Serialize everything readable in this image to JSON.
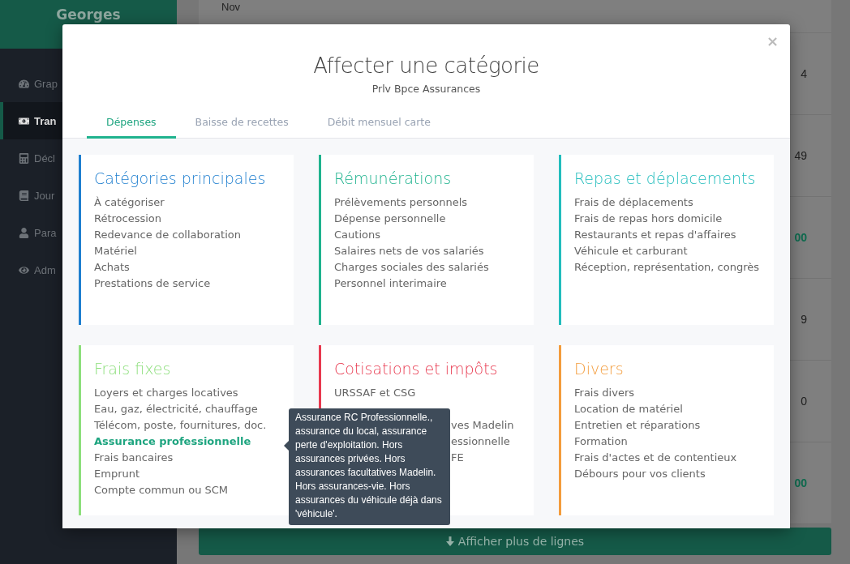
{
  "sidebar": {
    "user": "Georges",
    "items": [
      {
        "label": "Grap",
        "selected": false
      },
      {
        "label": "Tran",
        "selected": true
      },
      {
        "label": "Décl",
        "selected": false
      },
      {
        "label": "Jour",
        "selected": false
      },
      {
        "label": "Para",
        "selected": false
      },
      {
        "label": "Adm",
        "selected": false
      }
    ]
  },
  "table": {
    "first_row": "Nov",
    "rows": [
      {
        "amount": "4",
        "positive": false
      },
      {
        "amount": "49",
        "positive": false
      },
      {
        "amount": "00",
        "positive": true
      },
      {
        "amount": "9",
        "positive": false
      },
      {
        "amount": "0",
        "positive": false
      },
      {
        "amount": "00",
        "positive": true
      }
    ]
  },
  "more_button": "Afficher plus de lignes",
  "modal": {
    "title": "Affecter une catégorie",
    "subtitle": "Prlv Bpce Assurances",
    "close": "×",
    "tabs": [
      {
        "label": "Dépenses",
        "selected": true
      },
      {
        "label": "Baisse de recettes",
        "selected": false
      },
      {
        "label": "Débit mensuel carte",
        "selected": false
      }
    ],
    "groups": [
      {
        "title": "Catégories principales",
        "color": "#1f7fcf",
        "items": [
          {
            "text": "À catégoriser",
            "hovered": false
          },
          {
            "text": "Rétrocession",
            "hovered": false
          },
          {
            "text": "Redevance de collaboration",
            "hovered": false
          },
          {
            "text": "Matériel",
            "hovered": false
          },
          {
            "text": "Achats",
            "hovered": false
          },
          {
            "text": "Prestations de service",
            "hovered": false
          }
        ]
      },
      {
        "title": "Rémunérations",
        "color": "#1fb38e",
        "items": [
          {
            "text": "Prélèvements personnels",
            "hovered": false
          },
          {
            "text": "Dépense personnelle",
            "hovered": false
          },
          {
            "text": "Cautions",
            "hovered": false
          },
          {
            "text": "Salaires nets de vos salariés",
            "hovered": false
          },
          {
            "text": "Charges sociales des salariés",
            "hovered": false
          },
          {
            "text": "Personnel interimaire",
            "hovered": false
          }
        ]
      },
      {
        "title": "Repas et déplacements",
        "color": "#22bdbd",
        "items": [
          {
            "text": "Frais de déplacements",
            "hovered": false
          },
          {
            "text": "Frais de repas hors domicile",
            "hovered": false
          },
          {
            "text": "Restaurants et repas d'affaires",
            "hovered": false
          },
          {
            "text": "Véhicule et carburant",
            "hovered": false
          },
          {
            "text": "Réception, représentation, congrès",
            "hovered": false
          }
        ]
      },
      {
        "title": "Frais fixes",
        "color": "#8ddf7c",
        "items": [
          {
            "text": "Loyers et charges locatives",
            "hovered": false
          },
          {
            "text": "Eau, gaz, électricité, chauffage",
            "hovered": false
          },
          {
            "text": "Télécom, poste, fournitures, doc.",
            "hovered": false
          },
          {
            "text": "Assurance professionnelle",
            "hovered": true
          },
          {
            "text": "Frais bancaires",
            "hovered": false
          },
          {
            "text": "Emprunt",
            "hovered": false
          },
          {
            "text": "Compte commun ou SCM",
            "hovered": false
          }
        ]
      },
      {
        "title": "Cotisations et impôts",
        "color": "#e8394f",
        "items": [
          {
            "text": "URSSAF et CSG",
            "hovered": false,
            "kind": "plain"
          },
          {
            "text": "ves Madelin",
            "hovered": false,
            "kind": "covered",
            "gap_before": true
          },
          {
            "text": "essionnelle",
            "hovered": false,
            "kind": "covered"
          },
          {
            "text": "FE",
            "hovered": false,
            "kind": "covered"
          }
        ]
      },
      {
        "title": "Divers",
        "color": "#f39c3c",
        "items": [
          {
            "text": "Frais divers",
            "hovered": false
          },
          {
            "text": "Location de matériel",
            "hovered": false
          },
          {
            "text": "Entretien et réparations",
            "hovered": false
          },
          {
            "text": "Formation",
            "hovered": false
          },
          {
            "text": "Frais d'actes et de contentieux",
            "hovered": false
          },
          {
            "text": "Débours pour vos clients",
            "hovered": false
          }
        ]
      }
    ],
    "tooltip": "Assurance RC Professionnelle., assurance du local, assurance perte d'exploitation. Hors assurances privées. Hors assurances facultatives Madelin. Hors assurances-vie. Hors assurances du véhicule déjà dans 'véhicule'."
  }
}
